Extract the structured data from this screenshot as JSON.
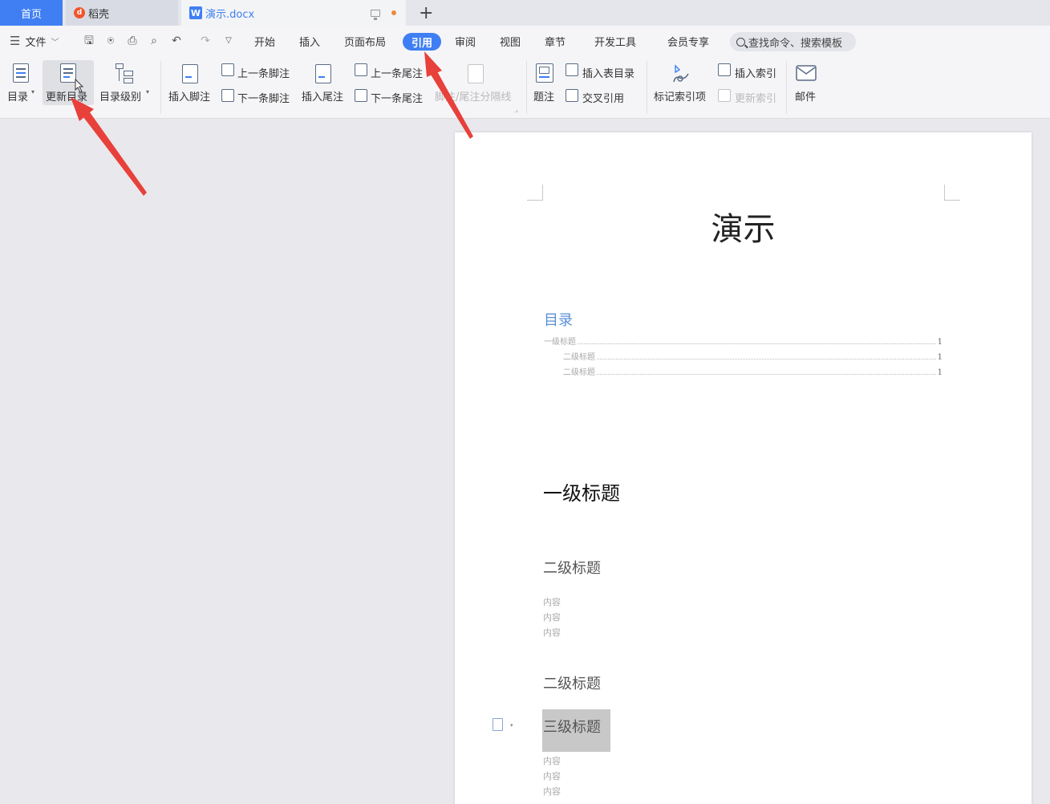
{
  "tabs": {
    "home": "首页",
    "daoke": "稻壳",
    "doc": "演示.docx",
    "new_tab": "+"
  },
  "menu": {
    "file": "文件",
    "items": [
      "开始",
      "插入",
      "页面布局",
      "引用",
      "审阅",
      "视图",
      "章节",
      "开发工具",
      "会员专享"
    ],
    "active": "引用",
    "search_label": "查找命令、搜索模板"
  },
  "ribbon": {
    "toc": "目录",
    "update_toc": "更新目录",
    "toc_level": "目录级别",
    "insert_footnote": "插入脚注",
    "prev_footnote": "上一条脚注",
    "next_footnote": "下一条脚注",
    "insert_endnote": "插入尾注",
    "prev_endnote": "上一条尾注",
    "next_endnote": "下一条尾注",
    "separator": "脚注/尾注分隔线",
    "caption": "题注",
    "insert_table_of_figures": "插入表目录",
    "cross_reference": "交叉引用",
    "mark_index_entry": "标记索引项",
    "insert_index": "插入索引",
    "update_index": "更新索引",
    "mail": "邮件"
  },
  "document": {
    "title": "演示",
    "toc_heading": "目录",
    "toc_entries": [
      {
        "label": "一级标题",
        "page": "1"
      },
      {
        "label": "二级标题",
        "page": "1"
      },
      {
        "label": "二级标题",
        "page": "1"
      }
    ],
    "heading1": "一级标题",
    "heading2_a": "二级标题",
    "content": "内容",
    "heading2_b": "二级标题",
    "heading3": "三级标题"
  },
  "colors": {
    "accent": "#3f7ff3",
    "arrow": "#e8403a",
    "toc_heading": "#5b8fd6"
  }
}
